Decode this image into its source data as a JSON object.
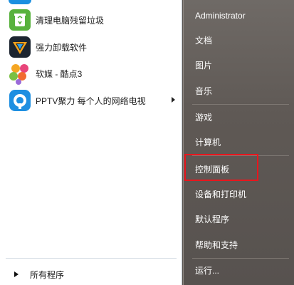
{
  "programs": [
    {
      "label": "清理电脑残留垃圾",
      "icon": "recycle-icon"
    },
    {
      "label": "强力卸载软件",
      "icon": "uninstall-icon"
    },
    {
      "label": "软媒 - 酷点3",
      "icon": "kudian-icon"
    },
    {
      "label": "PPTV聚力 每个人的网络电视",
      "icon": "pptv-icon",
      "has_submenu": true
    }
  ],
  "all_programs_label": "所有程序",
  "right_menu": [
    {
      "label": "Administrator"
    },
    {
      "label": "文档"
    },
    {
      "label": "图片"
    },
    {
      "label": "音乐"
    },
    {
      "label": "游戏"
    },
    {
      "label": "计算机"
    },
    {
      "label": "控制面板",
      "highlighted": true
    },
    {
      "label": "设备和打印机"
    },
    {
      "label": "默认程序"
    },
    {
      "label": "帮助和支持"
    },
    {
      "label": "运行..."
    }
  ],
  "colors": {
    "highlight_border": "#e8161d",
    "right_panel_bg": "#5f5955",
    "left_panel_bg": "#ffffff"
  }
}
